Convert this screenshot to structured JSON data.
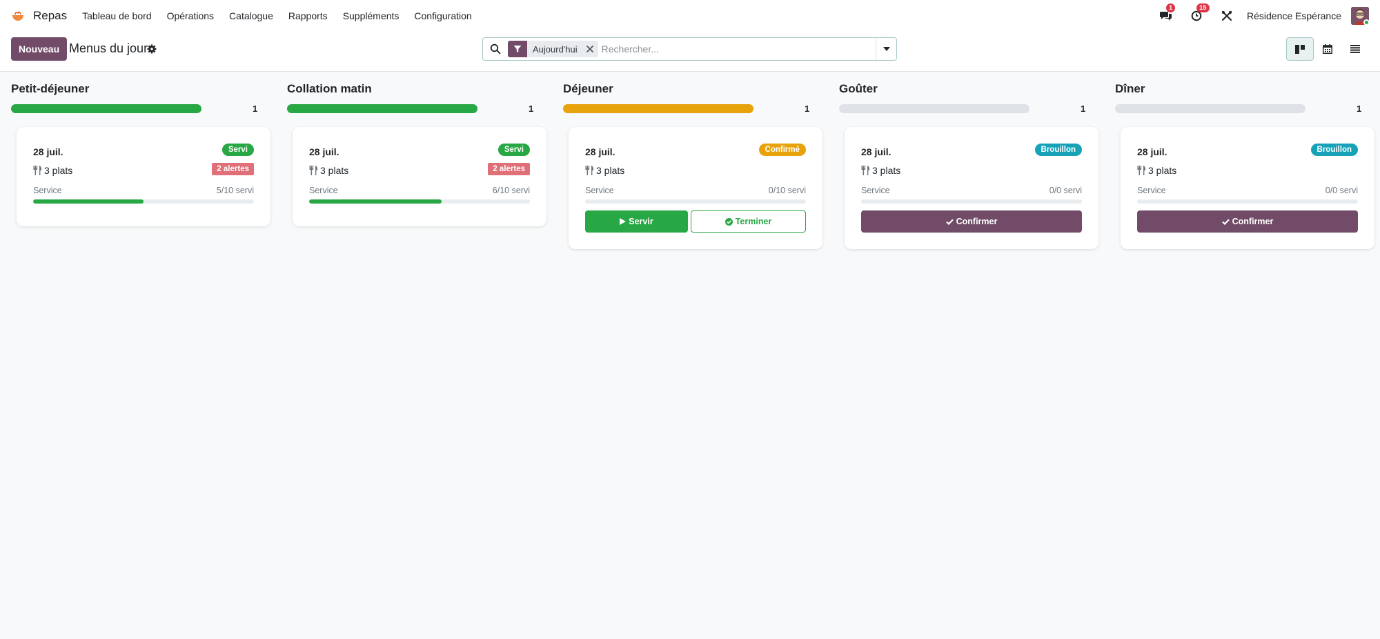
{
  "navbar": {
    "app_name": "Repas",
    "menu": [
      "Tableau de bord",
      "Opérations",
      "Catalogue",
      "Rapports",
      "Suppléments",
      "Configuration"
    ],
    "messages_count": "1",
    "activities_count": "15",
    "company": "Résidence Espérance"
  },
  "control_panel": {
    "new_button": "Nouveau",
    "title": "Menus du jour",
    "search": {
      "facet": "Aujourd'hui",
      "placeholder": "Rechercher..."
    },
    "views": [
      "kanban",
      "calendar",
      "list"
    ],
    "active_view": "kanban"
  },
  "colors": {
    "primary": "#714b67",
    "success": "#28a745",
    "warning": "#e8a20c",
    "info": "#17a2b8",
    "danger_soft": "#e06f78",
    "muted_bar": "#dee2e6"
  },
  "columns": [
    {
      "title": "Petit-déjeuner",
      "count": "1",
      "bar_color": "#28a745",
      "card": {
        "date": "28 juil.",
        "status": "Servi",
        "status_color": "#28a745",
        "plats": "3 plats",
        "alerts": "2 alertes",
        "service_label": "Service",
        "service_value": "5/10 servi",
        "service_progress": 0.5,
        "actions": []
      }
    },
    {
      "title": "Collation matin",
      "count": "1",
      "bar_color": "#28a745",
      "card": {
        "date": "28 juil.",
        "status": "Servi",
        "status_color": "#28a745",
        "plats": "3 plats",
        "alerts": "2 alertes",
        "service_label": "Service",
        "service_value": "6/10 servi",
        "service_progress": 0.6,
        "actions": []
      }
    },
    {
      "title": "Déjeuner",
      "count": "1",
      "bar_color": "#e8a20c",
      "card": {
        "date": "28 juil.",
        "status": "Confirmé",
        "status_color": "#e8a20c",
        "plats": "3 plats",
        "alerts": "",
        "service_label": "Service",
        "service_value": "0/10 servi",
        "service_progress": 0,
        "actions": [
          {
            "label": "Servir",
            "style": "success",
            "icon": "play-icon"
          },
          {
            "label": "Terminer",
            "style": "outline-success",
            "icon": "check-circle-icon"
          }
        ]
      }
    },
    {
      "title": "Goûter",
      "count": "1",
      "bar_color": "#dee2e6",
      "card": {
        "date": "28 juil.",
        "status": "Brouillon",
        "status_color": "#17a2b8",
        "plats": "3 plats",
        "alerts": "",
        "service_label": "Service",
        "service_value": "0/0 servi",
        "service_progress": 0,
        "actions": [
          {
            "label": "Confirmer",
            "style": "primary",
            "icon": "check-icon"
          }
        ]
      }
    },
    {
      "title": "Dîner",
      "count": "1",
      "bar_color": "#dee2e6",
      "card": {
        "date": "28 juil.",
        "status": "Brouillon",
        "status_color": "#17a2b8",
        "plats": "3 plats",
        "alerts": "",
        "service_label": "Service",
        "service_value": "0/0 servi",
        "service_progress": 0,
        "actions": [
          {
            "label": "Confirmer",
            "style": "primary",
            "icon": "check-icon"
          }
        ]
      }
    }
  ]
}
